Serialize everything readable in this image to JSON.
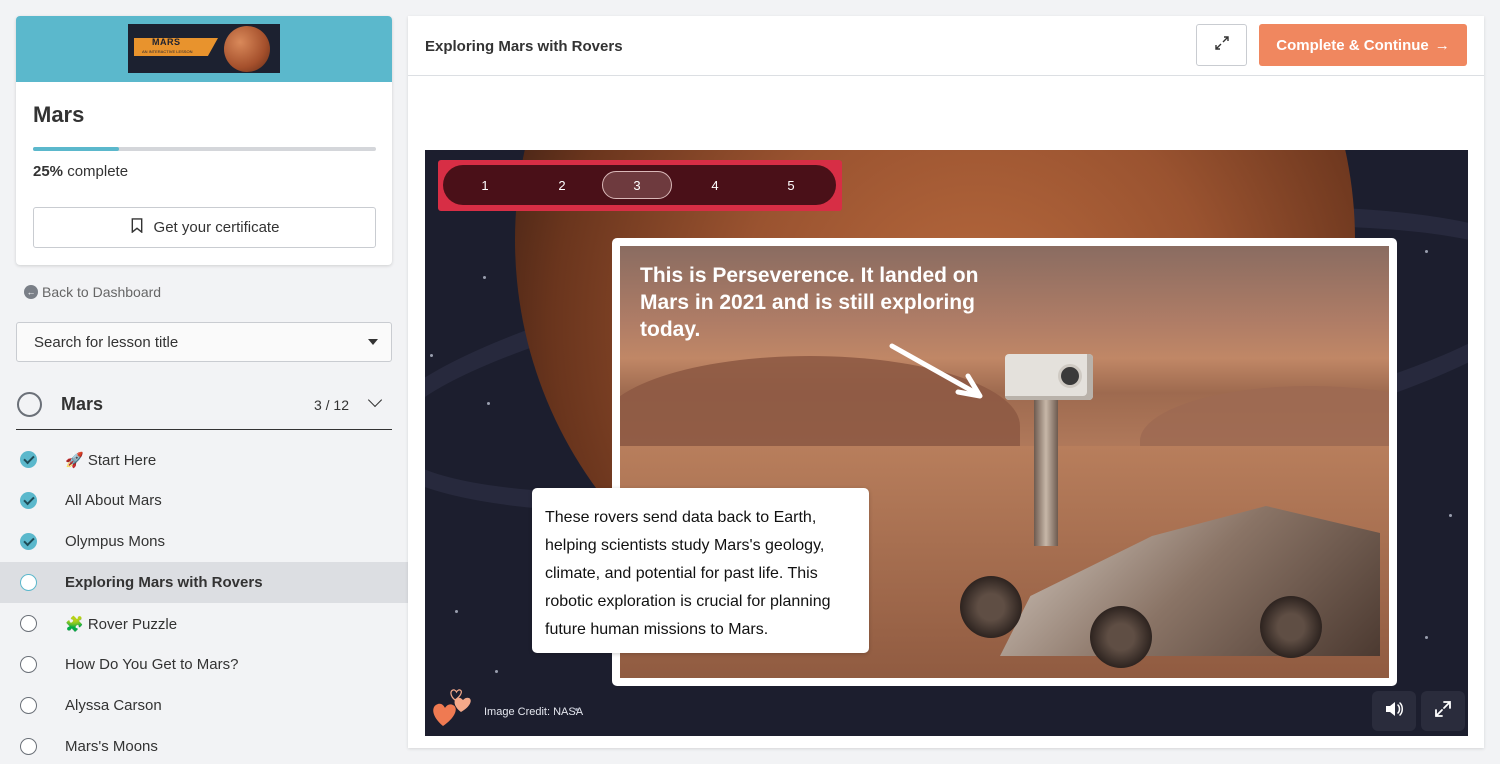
{
  "course": {
    "title": "Mars",
    "progress_percent": "25%",
    "progress_fraction": 0.25,
    "progress_suffix": "complete",
    "certificate_label": "Get your certificate",
    "banner": {
      "title": "MARS",
      "subtitle": "AN INTERACTIVE LESSON"
    }
  },
  "nav": {
    "back_label": "Back to Dashboard",
    "search_placeholder": "Search for lesson title"
  },
  "chapter": {
    "title": "Mars",
    "count": "3 / 12"
  },
  "lessons": [
    {
      "label": "🚀 Start Here",
      "status": "done"
    },
    {
      "label": "All About Mars",
      "status": "done"
    },
    {
      "label": "Olympus Mons",
      "status": "done"
    },
    {
      "label": "Exploring Mars with Rovers",
      "status": "current"
    },
    {
      "label": "🧩 Rover Puzzle",
      "status": "todo"
    },
    {
      "label": "How Do You Get to Mars?",
      "status": "todo"
    },
    {
      "label": "Alyssa Carson",
      "status": "todo"
    },
    {
      "label": "Mars's Moons",
      "status": "todo"
    }
  ],
  "header": {
    "lesson_title": "Exploring Mars with Rovers",
    "continue_label": "Complete & Continue",
    "continue_arrow": "→"
  },
  "slide": {
    "pages": [
      "1",
      "2",
      "3",
      "4",
      "5"
    ],
    "selected_page": "3",
    "headline": "This is Perseverence. It landed on Mars in 2021 and is still exploring today.",
    "body": "These rovers send data back to Earth, helping scientists study Mars's geology, climate, and potential for past life. This robotic exploration is crucial for planning future human missions to Mars.",
    "credit": "Image Credit: NASA"
  },
  "colors": {
    "accent": "#5bb8cc",
    "continue": "#f0875f",
    "pager": "#d72e45"
  }
}
